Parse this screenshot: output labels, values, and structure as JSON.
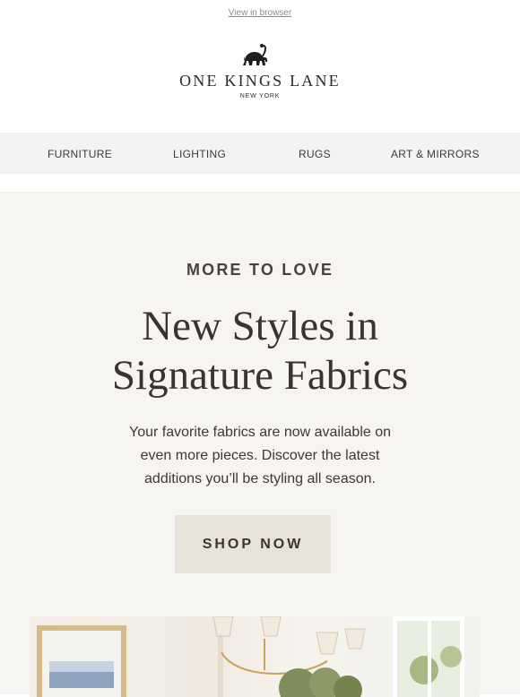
{
  "header": {
    "view_in_browser": "View in browser",
    "brand": "ONE KINGS LANE",
    "location": "NEW YORK"
  },
  "nav": {
    "items": [
      "FURNITURE",
      "LIGHTING",
      "RUGS",
      "ART & MIRRORS"
    ]
  },
  "hero": {
    "eyebrow": "MORE TO LOVE",
    "headline_line1": "New Styles in",
    "headline_line2": "Signature Fabrics",
    "body_line1": "Your favorite fabrics are now available on",
    "body_line2": "even more pieces. Discover the latest",
    "body_line3": "additions you’ll be styling all season.",
    "cta": "SHOP NOW"
  },
  "icons": {
    "logo": "elephant-icon"
  },
  "colors": {
    "nav_bg": "#f4f3f1",
    "hero_bg": "#f6f5f2",
    "button_bg": "#e8e3d8",
    "text_dark": "#3b3330"
  }
}
